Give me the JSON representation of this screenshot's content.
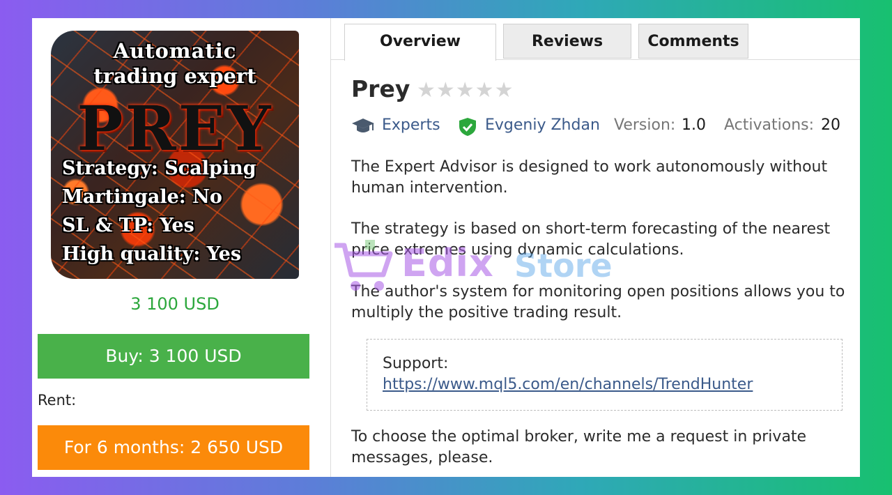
{
  "product_image": {
    "line1": "Automatic",
    "line2": "trading expert",
    "name": "PREY",
    "features": [
      "Strategy: Scalping",
      "Martingale: No",
      "SL & TP: Yes",
      "High quality: Yes"
    ]
  },
  "price": "3 100 USD",
  "buy_button": "Buy: 3 100 USD",
  "rent_label": "Rent:",
  "rent_button": "For 6 months: 2 650 USD",
  "tabs": [
    {
      "label": "Overview",
      "active": true
    },
    {
      "label": "Reviews",
      "active": false
    },
    {
      "label": "Comments",
      "active": false
    }
  ],
  "title": "Prey",
  "rating": {
    "stars": "★★★★★",
    "value": 0,
    "max": 5
  },
  "meta": {
    "category": "Experts",
    "author": "Evgeniy Zhdan",
    "version_label": "Version:",
    "version": "1.0",
    "activations_label": "Activations:",
    "activations": "20"
  },
  "description": [
    "The Expert Advisor is designed to work autonomously without human intervention.",
    "The strategy is based on short-term forecasting of the nearest price extremes using dynamic calculations.",
    "The author's system for monitoring open positions allows you to multiply the positive trading result."
  ],
  "support": {
    "label": "Support:",
    "link": "https://www.mql5.com/en/channels/TrendHunter"
  },
  "footer_text": "To choose the optimal broker, write me a request in private messages, please.",
  "watermark": {
    "text1": "Edix",
    "text2": "Store"
  },
  "colors": {
    "price_green": "#2ca73c",
    "buy_green": "#49b14a",
    "rent_orange": "#fb8a0a",
    "link_blue": "#3b5a8a",
    "star_gray": "#d4d4d4"
  }
}
